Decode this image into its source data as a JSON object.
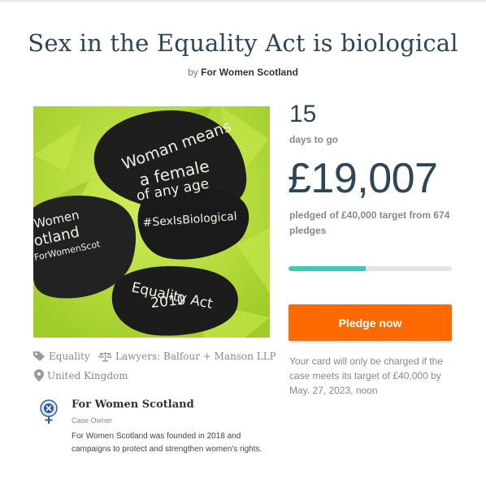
{
  "page": {
    "title": "Sex in the Equality Act is biological",
    "byline_prefix": "by",
    "organizer": "For Women Scotland"
  },
  "hero": {
    "stone_texts": [
      "Woman means",
      "a female",
      "of any age",
      "#SexIsBiological",
      "Women",
      "otland",
      "ForWomenScot",
      "Equality Act",
      "2010"
    ],
    "colors": {
      "background": "#b8dd3a",
      "stone": "#1c1c1c"
    }
  },
  "stats": {
    "days_value": "15",
    "days_label": "days to go",
    "amount": "£19,007",
    "pledged_text": "pledged of £40,000 target from 674 pledges",
    "progress_fraction": 0.475
  },
  "cta": {
    "pledge_label": "Pledge now",
    "charge_note": "Your card will only be charged if the case meets its target of £40,000 by May. 27, 2023, noon"
  },
  "meta": {
    "category": "Equality",
    "lawyers": "Lawyers: Balfour + Manson LLP",
    "location": "United Kingdom"
  },
  "owner": {
    "name": "For Women Scotland",
    "role": "Case Owner",
    "description": "For Women Scotland was founded in 2018 and campaigns to protect and strengthen women's rights."
  },
  "colors": {
    "accent": "#ff6a00",
    "progress": "#3fc8b4",
    "heading": "#2d4658"
  }
}
